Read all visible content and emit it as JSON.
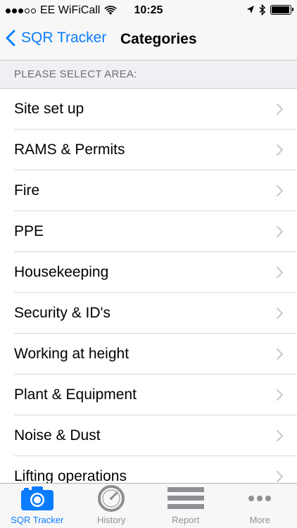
{
  "status_bar": {
    "carrier": "EE WiFiCall",
    "time": "10:25",
    "battery_level": 0.95
  },
  "nav": {
    "back_label": "SQR Tracker",
    "title": "Categories"
  },
  "section_header": "PLEASE SELECT AREA:",
  "categories": [
    {
      "label": "Site set up"
    },
    {
      "label": "RAMS & Permits"
    },
    {
      "label": "Fire"
    },
    {
      "label": "PPE"
    },
    {
      "label": "Housekeeping"
    },
    {
      "label": "Security & ID's"
    },
    {
      "label": "Working at height"
    },
    {
      "label": "Plant & Equipment"
    },
    {
      "label": "Noise & Dust"
    },
    {
      "label": "Lifting operations"
    }
  ],
  "tabs": [
    {
      "label": "SQR Tracker",
      "icon": "camera-icon",
      "active": true
    },
    {
      "label": "History",
      "icon": "clock-icon",
      "active": false
    },
    {
      "label": "Report",
      "icon": "report-lines-icon",
      "active": false
    },
    {
      "label": "More",
      "icon": "more-dots-icon",
      "active": false
    }
  ],
  "colors": {
    "accent": "#0a7cff",
    "inactive": "#929292",
    "section_bg": "#efeff4"
  }
}
